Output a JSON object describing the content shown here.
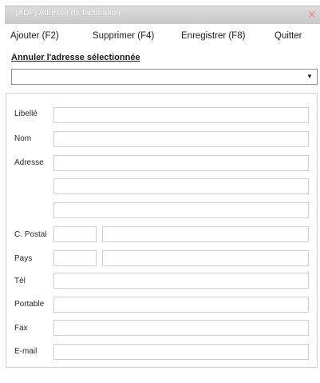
{
  "window": {
    "title": "(ADF) Adresse de facturation",
    "close_glyph": "✕"
  },
  "menu": {
    "add": "Ajouter (F2)",
    "delete": "Supprimer (F4)",
    "save": "Enregistrer (F8)",
    "quit": "Quitter"
  },
  "cancel_link": "Annuler l'adresse sélectionnée",
  "address_select": {
    "value": "",
    "arrow_glyph": "▼"
  },
  "form": {
    "label_libelle": "Libellé",
    "label_nom": "Nom",
    "label_adresse": "Adresse",
    "label_cpostal": "C. Postal",
    "label_pays": "Pays",
    "label_tel": "Tél",
    "label_portable": "Portable",
    "label_fax": "Fax",
    "label_email": "E-mail"
  }
}
